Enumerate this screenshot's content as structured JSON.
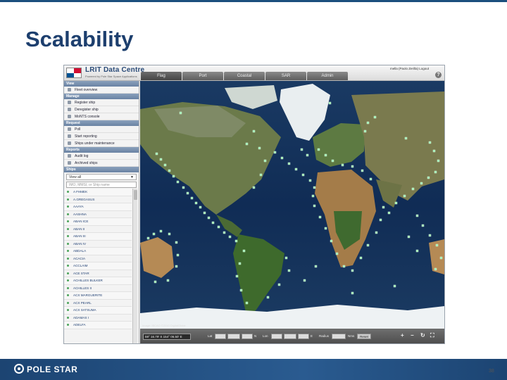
{
  "slide": {
    "title": "Scalability",
    "page_number": "38",
    "footer_logo_text": "POLE STAR"
  },
  "app": {
    "name": "LRIT Data Centre",
    "subtitle": "Powered by Pole Star Space Applications",
    "user_info": "mella (Paolo Zerilla) Logout",
    "tabs": [
      "Flag",
      "Port",
      "Coastal",
      "SAR",
      "Admin"
    ],
    "active_tab": "Flag",
    "sidebar": {
      "sections": [
        {
          "title": "View",
          "items": [
            "Fleet overview"
          ]
        },
        {
          "title": "Manage",
          "items": [
            "Register ship",
            "Deregister ship",
            "MoNTS console"
          ]
        },
        {
          "title": "Request",
          "items": [
            "Poll",
            "Start reporting",
            "Ships under maintenance"
          ]
        },
        {
          "title": "Reports",
          "items": [
            "Audit log",
            "Archived ships"
          ]
        }
      ],
      "ships_header": "Ships",
      "view_select": "View all",
      "search_placeholder": "IMO, MMSI, or Ship name",
      "ships": [
        "A FHMEK",
        "A.GREGASUS",
        "AAAYA",
        "AASHNA",
        "ABAN ICE",
        "ABAN II",
        "ABAN III",
        "ABAN IV",
        "ABDALA",
        "ACACIA",
        "ACCLAIM",
        "ACE STAR",
        "ACHILLES BULKER",
        "ACHILLES II",
        "ACX MARGUERITE",
        "ACX PEARL",
        "ACX SATSUMA",
        "ADAMAS I",
        "ADELFA"
      ]
    },
    "map": {
      "attribution": "Image: IBCAO ©2010 DigitalGlobe",
      "marker_color": "#9bf0b0"
    },
    "bottom_bar": {
      "coordinates": "59° 16.79' S 154° 06.50' E",
      "lat_label": "Lat",
      "lat_hemi": "N",
      "lon_label": "Lon",
      "lon_hemi": "E",
      "radius_label": "Radius",
      "units_label": "Nms",
      "reset_label": "Reset"
    }
  }
}
